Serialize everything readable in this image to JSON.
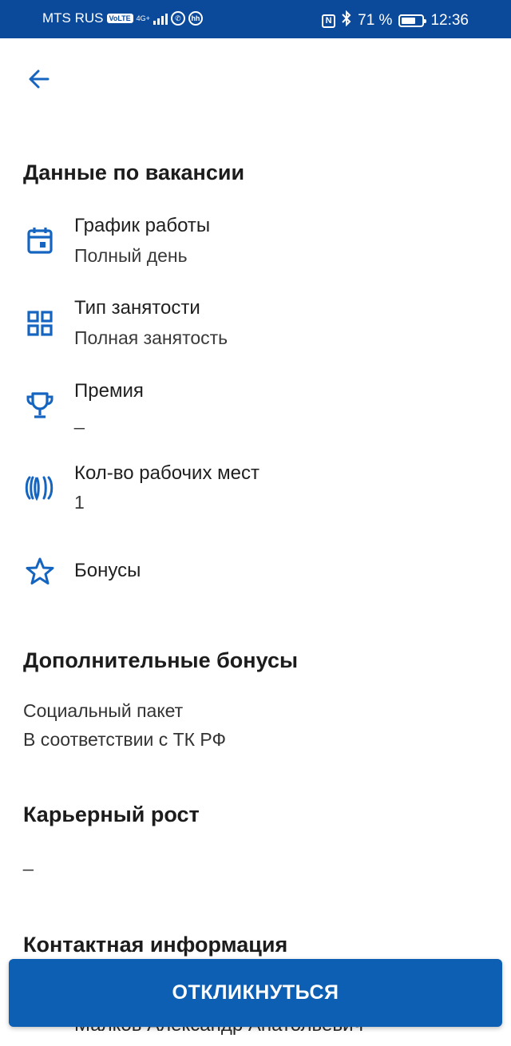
{
  "status_bar": {
    "carrier": "MTS RUS",
    "volte": "VoLTE",
    "network": "4G+",
    "hh": "hh",
    "nfc": "N",
    "battery_percent": "71 %",
    "battery_level": 0.71,
    "time": "12:36"
  },
  "vacancy_section": {
    "title": "Данные по вакансии",
    "rows": [
      {
        "label": "График работы",
        "value": "Полный день",
        "icon": "calendar-icon"
      },
      {
        "label": "Тип занятости",
        "value": "Полная занятость",
        "icon": "grid-icon"
      },
      {
        "label": "Премия",
        "value": "_",
        "icon": "trophy-icon"
      },
      {
        "label": "Кол-во рабочих мест",
        "value": "1",
        "icon": "workplaces-icon"
      },
      {
        "label": "Бонусы",
        "icon": "star-icon"
      }
    ]
  },
  "extra_bonuses": {
    "title": "Дополнительные бонусы",
    "lines": [
      "Социальный пакет",
      "В соответствии с ТК РФ"
    ]
  },
  "career": {
    "title": "Карьерный рост",
    "value": "_"
  },
  "contacts": {
    "title": "Контактная информация",
    "name": "Малков Александр Анатольевич -"
  },
  "actions": {
    "respond_label": "ОТКЛИКНУТЬСЯ"
  },
  "colors": {
    "accent": "#0d5fb3",
    "status_bar": "#0b4a9b",
    "icon": "#1565c0"
  }
}
